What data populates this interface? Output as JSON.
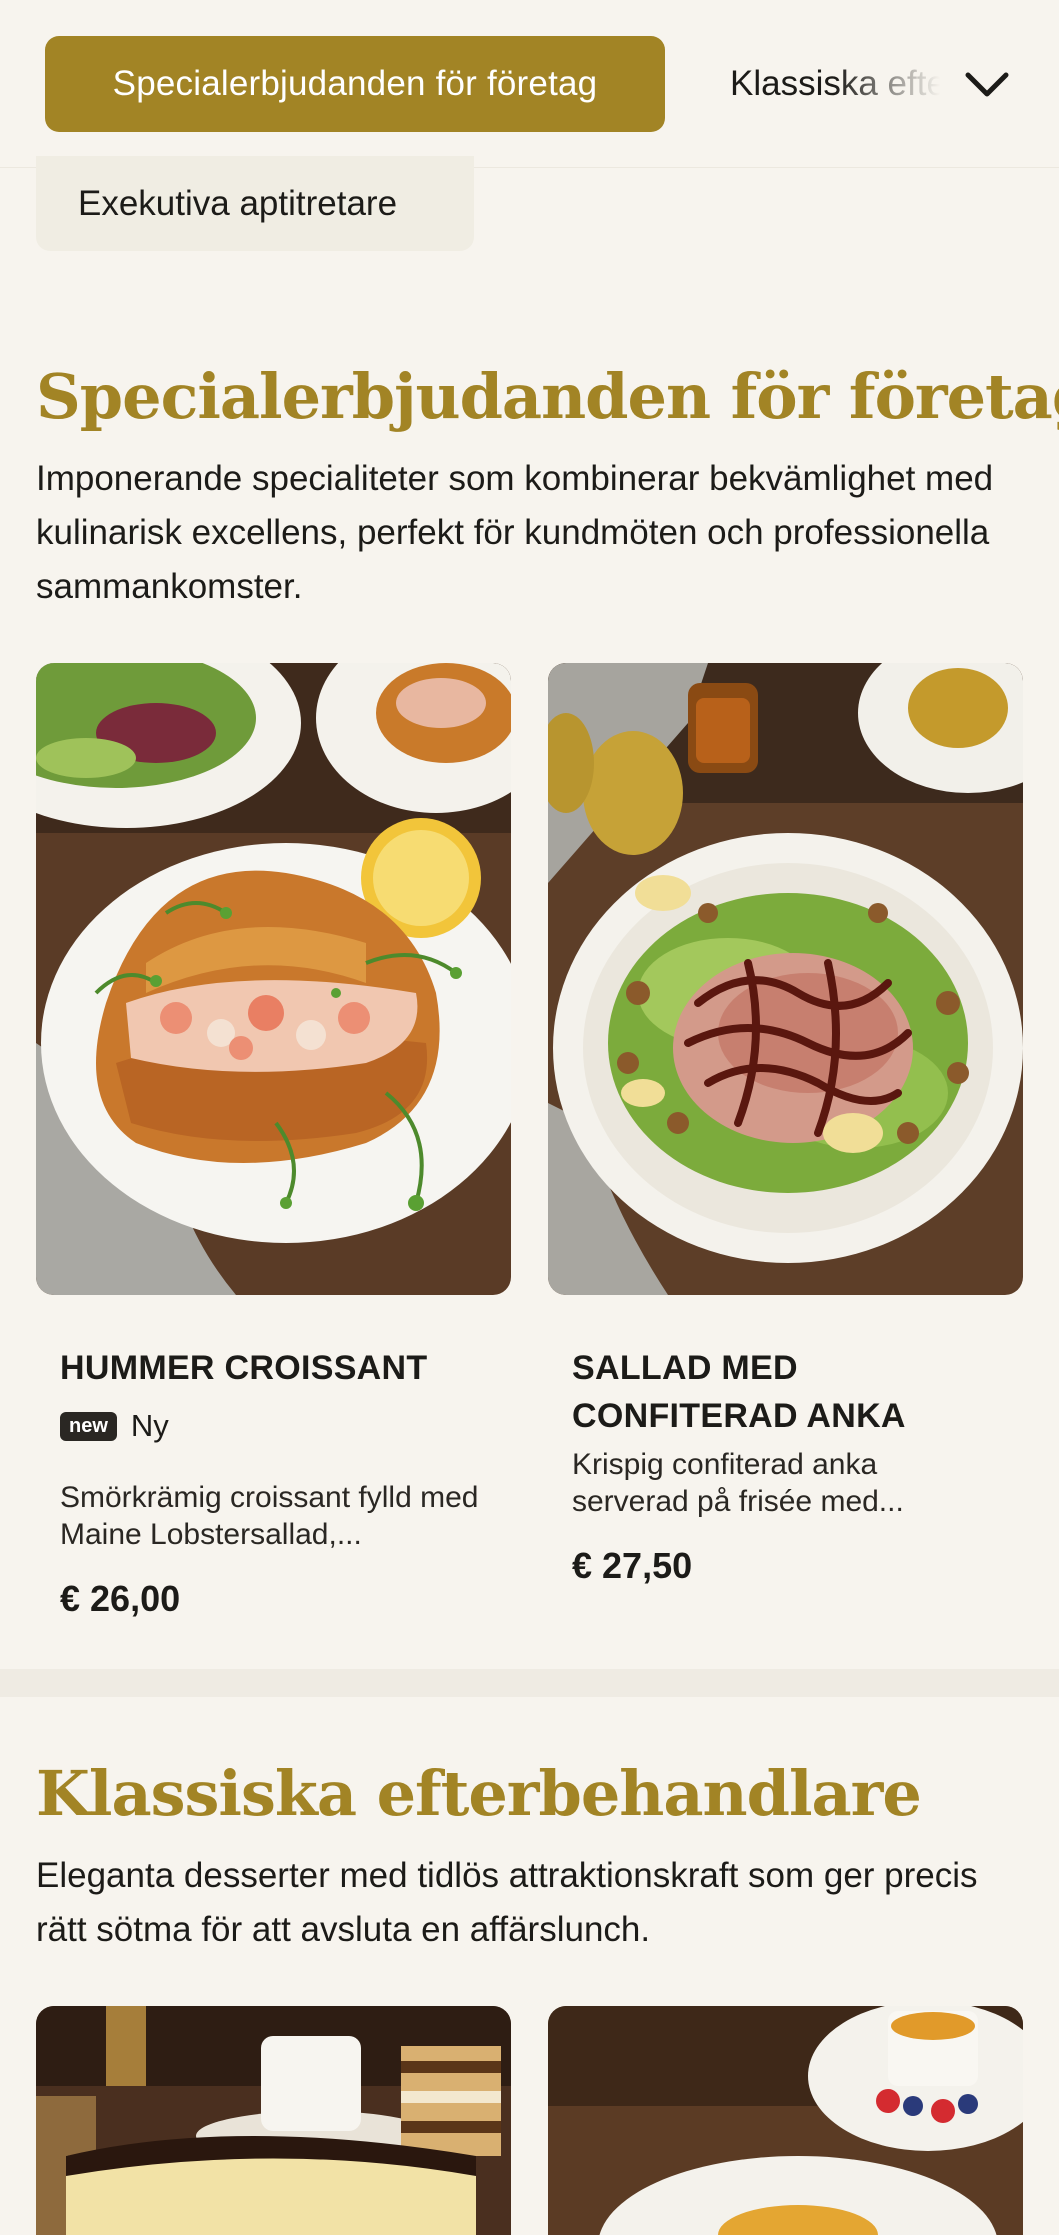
{
  "category_nav": {
    "active": "Specialerbjudanden för företag",
    "next": "Klassiska efterbehandlare",
    "previous": "Exekutiva aptitretare"
  },
  "sections": [
    {
      "title": "Specialerbjudanden för företag",
      "description": "Imponerande specialiteter som kombinerar bekvämlighet med kulinarisk excellens, perfekt för kundmöten och professionella sammankomster.",
      "items": [
        {
          "name": "HUMMER CROISSANT",
          "badge": "new",
          "badge_text": "Ny",
          "description": "Smörkrämig croissant fylld med Maine Lobstersallad,...",
          "price": "€ 26,00"
        },
        {
          "name": "SALLAD MED CONFITERAD ANKA",
          "description": "Krispig confiterad anka serverad på frisée med...",
          "price": "€ 27,50"
        }
      ]
    },
    {
      "title": "Klassiska efterbehandlare",
      "description": "Eleganta desserter med tidlös attraktionskraft som ger precis rätt sötma för att avsluta en affärslunch."
    }
  ],
  "colors": {
    "accent": "#a28425",
    "background": "#f7f4ee",
    "badge": "#2a2723"
  },
  "icons": {
    "dropdown": "chevron-down-icon"
  }
}
